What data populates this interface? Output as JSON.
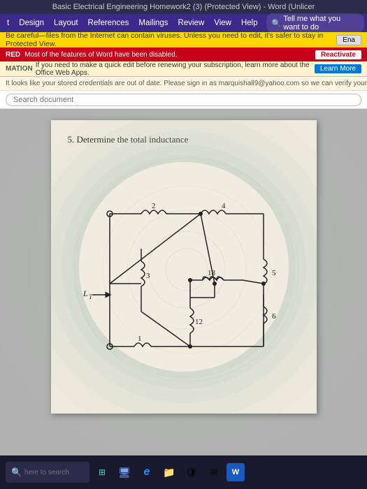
{
  "title_bar": {
    "text": "Basic Electrical Engineering Homework2 (3) (Protected View) - Word (Unlicer"
  },
  "menu_bar": {
    "items": [
      "t",
      "Design",
      "Layout",
      "References",
      "Mailings",
      "Review",
      "View",
      "Help",
      "🔍 Tell me what you want to do"
    ]
  },
  "notif_virus": {
    "message": "Be careful—files from the Internet can contain viruses. Unless you need to edit, it's safer to stay in Protected View.",
    "button": "Ena"
  },
  "notif_red": {
    "label": "RED",
    "message": "Most of the features of Word have been disabled.",
    "button": "Reactivate"
  },
  "notif_info": {
    "label": "MATION",
    "message": "If you need to make a quick edit before renewing your subscription, learn more about the Office Web Apps.",
    "button": "Learn More"
  },
  "notif_signin": {
    "message": "It looks like your stored credentials are out of date. Please sign in as marquishall9@yahoo.com so we can verify your subscripti"
  },
  "document": {
    "problem_number": "5.",
    "problem_text": "Determine the total inductance",
    "lt_label": "L",
    "lt_sub": "T",
    "circuit": {
      "nodes": {
        "labels": [
          "2",
          "4",
          "3",
          "18",
          "5",
          "12",
          "6",
          "1"
        ]
      }
    }
  },
  "taskbar": {
    "search_placeholder": "here to search",
    "icons": [
      "⊞",
      "e",
      "📁",
      "🛡",
      "✉",
      "W"
    ]
  }
}
